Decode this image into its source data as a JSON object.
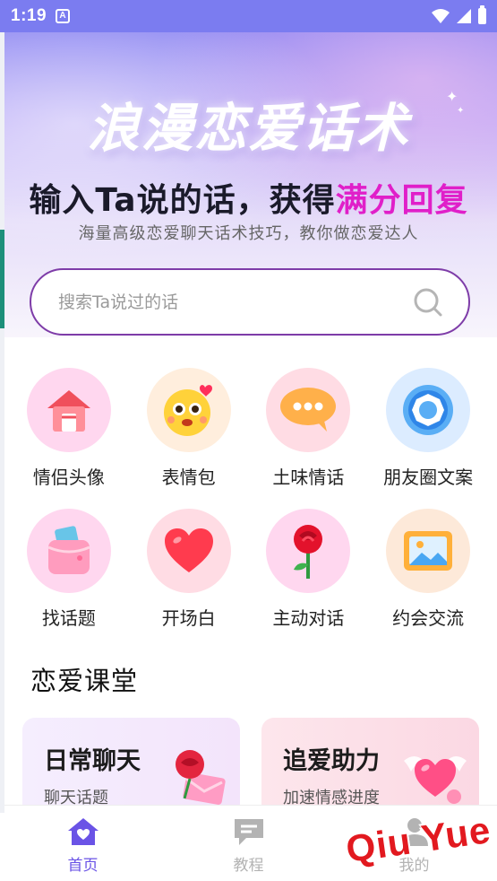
{
  "status_bar": {
    "time": "1:19",
    "badge": "A"
  },
  "hero": {
    "title": "浪漫恋爱话术",
    "headline_prefix": "输入Ta说的话，获得",
    "headline_accent": "满分回复",
    "subtitle": "海量高级恋爱聊天话术技巧，教你做恋爱达人"
  },
  "search": {
    "placeholder": "搜索Ta说过的话",
    "value": ""
  },
  "features": [
    {
      "label": "情侣头像",
      "icon": "house-icon"
    },
    {
      "label": "表情包",
      "icon": "emoji-face-icon"
    },
    {
      "label": "土味情话",
      "icon": "chat-bubble-icon"
    },
    {
      "label": "朋友圈文案",
      "icon": "aperture-icon"
    },
    {
      "label": "找话题",
      "icon": "wallet-icon"
    },
    {
      "label": "开场白",
      "icon": "heart-icon"
    },
    {
      "label": "主动对话",
      "icon": "rose-icon"
    },
    {
      "label": "约会交流",
      "icon": "picture-icon"
    }
  ],
  "section": {
    "title": "恋爱课堂"
  },
  "cards": [
    {
      "title": "日常聊天",
      "subtitle": "聊天话题",
      "icon": "rose-envelope-icon"
    },
    {
      "title": "追爱助力",
      "subtitle": "加速情感进度",
      "icon": "winged-heart-icon"
    }
  ],
  "bottom_nav": [
    {
      "label": "首页",
      "icon": "home-icon",
      "active": true
    },
    {
      "label": "教程",
      "icon": "message-icon",
      "active": false
    },
    {
      "label": "我的",
      "icon": "person-icon",
      "active": false
    }
  ],
  "watermark": {
    "text": "Qiu Yue"
  },
  "colors": {
    "accent_purple": "#6a53e6",
    "headline_accent": "#e01fc9",
    "search_border": "#7e3ca8",
    "watermark": "#e2191f"
  }
}
